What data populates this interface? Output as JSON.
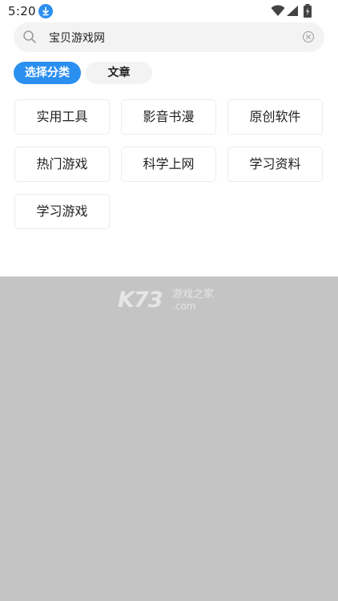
{
  "status_bar": {
    "time": "5:20"
  },
  "search": {
    "value": "宝贝游戏网",
    "placeholder": ""
  },
  "tabs": [
    {
      "label": "选择分类",
      "active": true
    },
    {
      "label": "文章",
      "active": false
    }
  ],
  "categories": [
    {
      "label": "实用工具"
    },
    {
      "label": "影音书漫"
    },
    {
      "label": "原创软件"
    },
    {
      "label": "热门游戏"
    },
    {
      "label": "科学上网"
    },
    {
      "label": "学习资料"
    },
    {
      "label": "学习游戏"
    }
  ],
  "watermark": {
    "logo": "K73",
    "text_line1": "游戏之家",
    "text_line2": ".com"
  },
  "colors": {
    "accent": "#2b8ff0",
    "overlay": "#c4c4c4",
    "panel": "#ffffff"
  }
}
